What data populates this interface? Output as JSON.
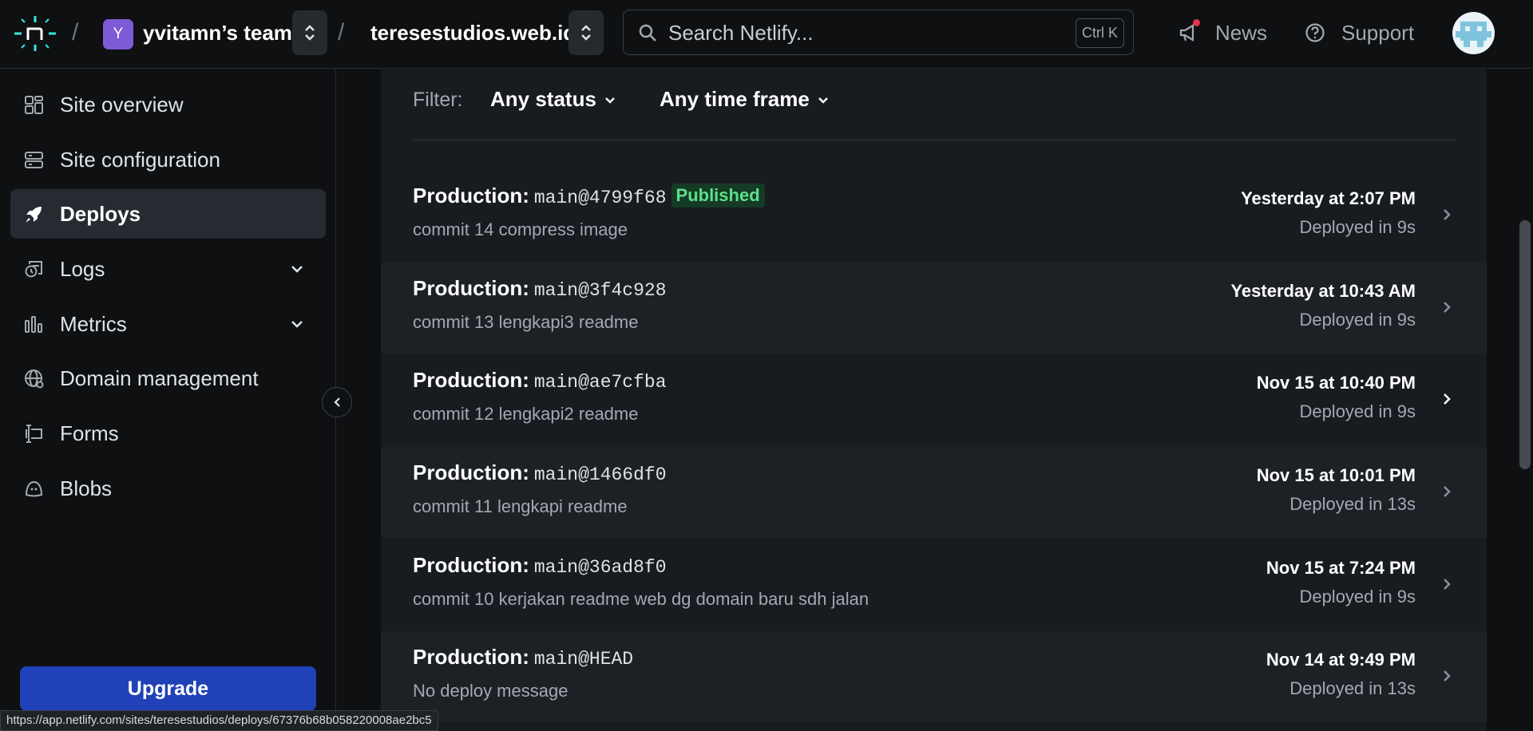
{
  "header": {
    "breadcrumb_sep": "/",
    "team": {
      "initial": "Y",
      "name": "yvitamn’s team"
    },
    "site": {
      "name": "teresestudios.web.id"
    },
    "search": {
      "placeholder": "Search Netlify...",
      "shortcut": "Ctrl K"
    },
    "links": {
      "news": "News",
      "support": "Support"
    }
  },
  "sidebar": {
    "items": [
      {
        "label": "Site overview",
        "icon": "grid-icon"
      },
      {
        "label": "Site configuration",
        "icon": "server-icon"
      },
      {
        "label": "Deploys",
        "icon": "rocket-icon",
        "active": true
      },
      {
        "label": "Logs",
        "icon": "logs-icon",
        "expandable": true
      },
      {
        "label": "Metrics",
        "icon": "bar-chart-icon",
        "expandable": true
      },
      {
        "label": "Domain management",
        "icon": "globe-icon"
      },
      {
        "label": "Forms",
        "icon": "form-icon"
      },
      {
        "label": "Blobs",
        "icon": "blob-icon"
      }
    ],
    "upgrade_label": "Upgrade"
  },
  "filters": {
    "label": "Filter:",
    "status": "Any status",
    "timeframe": "Any time frame"
  },
  "deploys": [
    {
      "context": "Production:",
      "ref": "main@4799f68",
      "badge": "Published",
      "message": "commit 14 compress image",
      "time": "Yesterday at 2:07 PM",
      "duration": "Deployed in 9s"
    },
    {
      "context": "Production:",
      "ref": "main@3f4c928",
      "message": "commit 13 lengkapi3 readme",
      "time": "Yesterday at 10:43 AM",
      "duration": "Deployed in 9s"
    },
    {
      "context": "Production:",
      "ref": "main@ae7cfba",
      "message": "commit 12 lengkapi2 readme",
      "time": "Nov 15 at 10:40 PM",
      "duration": "Deployed in 9s"
    },
    {
      "context": "Production:",
      "ref": "main@1466df0",
      "message": "commit 11 lengkapi readme",
      "time": "Nov 15 at 10:01 PM",
      "duration": "Deployed in 13s"
    },
    {
      "context": "Production:",
      "ref": "main@36ad8f0",
      "message": "commit 10 kerjakan readme web dg domain baru sdh jalan",
      "time": "Nov 15 at 7:24 PM",
      "duration": "Deployed in 9s"
    },
    {
      "context": "Production:",
      "ref": "main@HEAD",
      "message": "No deploy message",
      "time": "Nov 14 at 9:49 PM",
      "duration": "Deployed in 13s"
    }
  ],
  "status_bar": {
    "url": "https://app.netlify.com/sites/teresestudios/deploys/67376b68b058220008ae2bc5"
  },
  "colors": {
    "accent": "#32e6e2",
    "published_text": "#5ce08a",
    "upgrade": "#2141b8",
    "team_avatar": "#7e5bd6",
    "news_dot": "#e5334b"
  }
}
